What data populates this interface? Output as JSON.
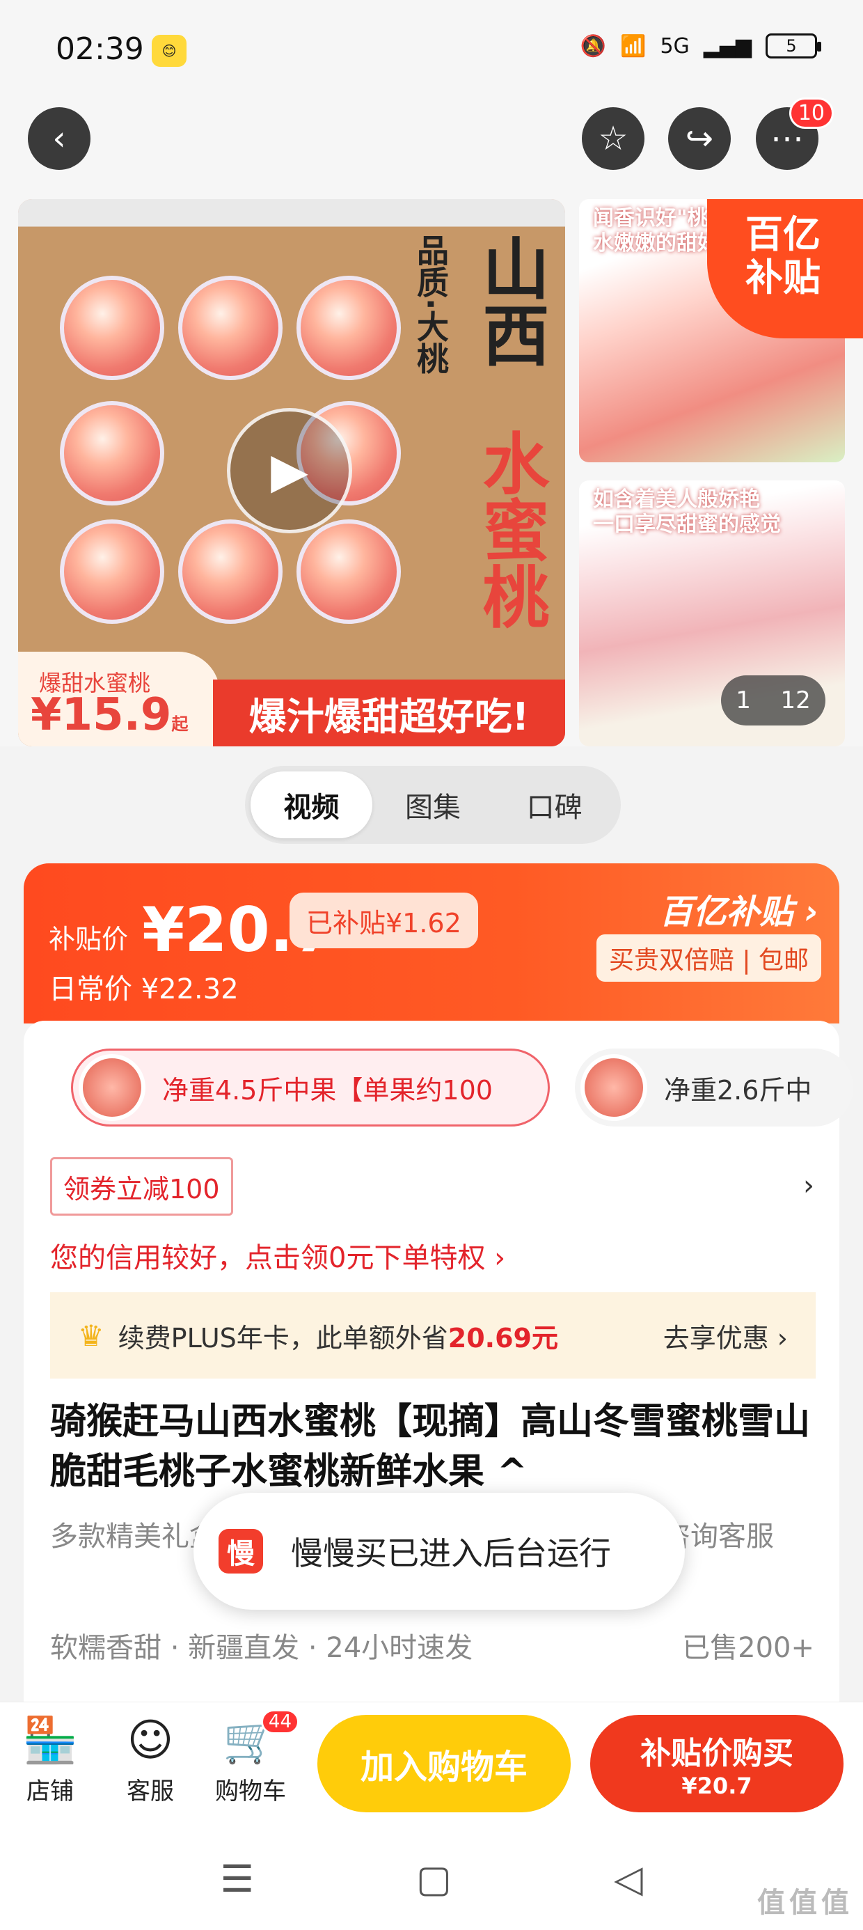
{
  "status": {
    "time": "02:39",
    "network": "5G",
    "battery": "5"
  },
  "topnav": {
    "notification_count": "10"
  },
  "gallery": {
    "main_quality": "品质·大桃",
    "main_title_black": "山西",
    "main_title_red": "水蜜桃",
    "price_label": "爆甜水蜜桃",
    "price_value": "¥15.9",
    "price_suffix": "起",
    "banner": "爆汁爆甜超好吃!",
    "thumb1_text": "闻香识好\"桃\"\n水嫩嫩的甜好",
    "thumb2_text": "如含着美人般娇艳\n一口享尽甜蜜的感觉",
    "subsidy_corner": "百亿\n补贴",
    "counter_current": "1",
    "counter_total": "12"
  },
  "tabs": [
    "视频",
    "图集",
    "口碑"
  ],
  "price_card": {
    "label": "补贴价",
    "price": "¥20.7",
    "subsidized": "已补贴¥1.62",
    "daily": "日常价 ¥22.32",
    "brand": "百亿补贴",
    "guarantee": "买贵双倍赔 | 包邮"
  },
  "sku": {
    "selected": "净重4.5斤中果【单果约100",
    "other": "净重2.6斤中"
  },
  "coupon": "领券立减100",
  "credit": "您的信用较好，点击领0元下单特权 ›",
  "plus": {
    "text": "续费PLUS年卡，此单额外省",
    "amount": "20.69元",
    "go": "去享优惠 ›"
  },
  "product": {
    "title": "骑猴赶马山西水蜜桃【现摘】高山冬雪蜜桃雪山脆甜毛桃子水蜜桃新鲜水果 ^",
    "desc": "多款精美礼盒可选，送礼自用皆宜，发团购送礼请咨询客服",
    "meta": "软糯香甜 · 新疆直发 · 24小时速发",
    "sold": "已售200+"
  },
  "toast": {
    "icon": "慢",
    "text": "慢慢买已进入后台运行"
  },
  "bottombar": {
    "shop": "店铺",
    "service": "客服",
    "cart": "购物车",
    "cart_count": "44",
    "add_cart": "加入购物车",
    "buy_label": "补贴价购买",
    "buy_price": "¥20.7"
  },
  "watermark": "值值值"
}
